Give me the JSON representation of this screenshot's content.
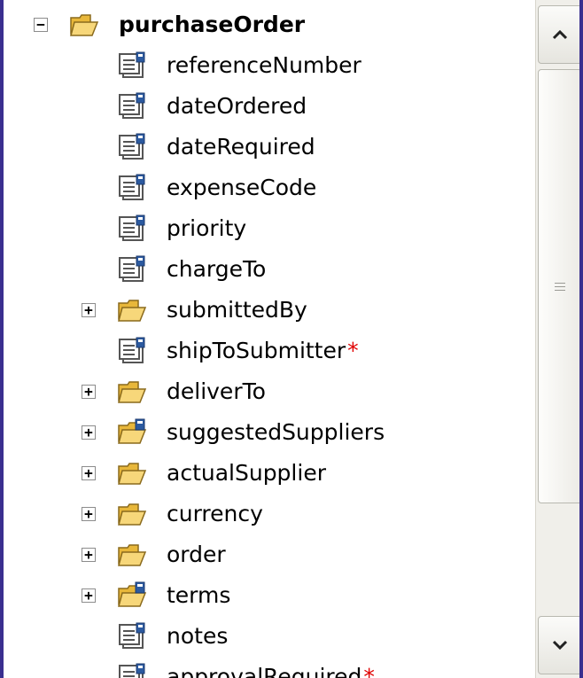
{
  "tree": {
    "root": {
      "label": "purchaseOrder",
      "expander": "−",
      "icon": "open-folder-icon"
    },
    "items": [
      {
        "label": "referenceNumber",
        "icon": "element-icon",
        "expander": "",
        "required": ""
      },
      {
        "label": "dateOrdered",
        "icon": "element-icon",
        "expander": "",
        "required": ""
      },
      {
        "label": "dateRequired",
        "icon": "element-icon",
        "expander": "",
        "required": ""
      },
      {
        "label": "expenseCode",
        "icon": "element-icon",
        "expander": "",
        "required": ""
      },
      {
        "label": "priority",
        "icon": "element-icon",
        "expander": "",
        "required": ""
      },
      {
        "label": "chargeTo",
        "icon": "element-icon",
        "expander": "",
        "required": ""
      },
      {
        "label": "submittedBy",
        "icon": "folder-icon",
        "expander": "+",
        "required": ""
      },
      {
        "label": "shipToSubmitter",
        "icon": "element-icon",
        "expander": "",
        "required": "*"
      },
      {
        "label": "deliverTo",
        "icon": "folder-icon",
        "expander": "+",
        "required": ""
      },
      {
        "label": "suggestedSuppliers",
        "icon": "folder-element-icon",
        "expander": "+",
        "required": ""
      },
      {
        "label": "actualSupplier",
        "icon": "folder-icon",
        "expander": "+",
        "required": ""
      },
      {
        "label": "currency",
        "icon": "folder-icon",
        "expander": "+",
        "required": ""
      },
      {
        "label": "order",
        "icon": "folder-icon",
        "expander": "+",
        "required": ""
      },
      {
        "label": "terms",
        "icon": "folder-element-icon",
        "expander": "+",
        "required": ""
      },
      {
        "label": "notes",
        "icon": "element-icon",
        "expander": "",
        "required": ""
      },
      {
        "label": "approvalRequired",
        "icon": "element-icon",
        "expander": "",
        "required": "*"
      }
    ]
  },
  "scrollbar": {
    "up_icon": "chevron-up-icon",
    "down_icon": "chevron-down-icon",
    "grip_icon": "grip-icon"
  },
  "colors": {
    "required": "#e00000",
    "folder": "#f2c94c",
    "frame": "#3a2f8f"
  }
}
